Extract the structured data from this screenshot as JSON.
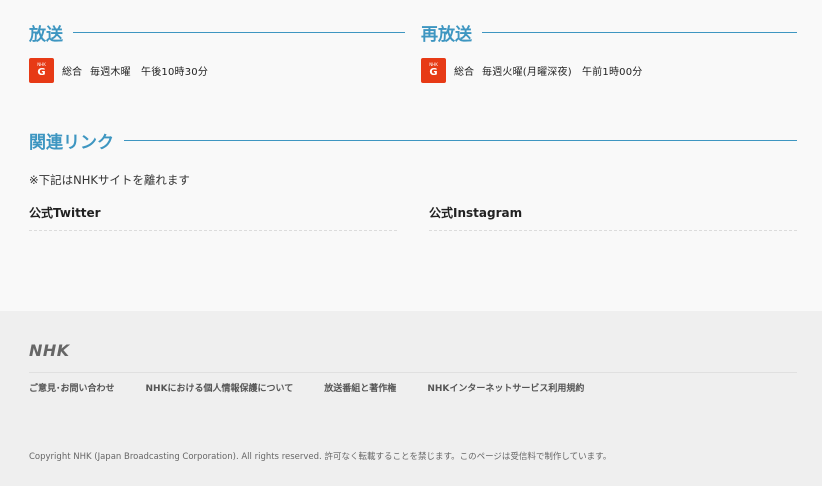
{
  "broadcast": {
    "title": "放送",
    "badge_small": "NHK",
    "badge_letter": "G",
    "channel": "総合",
    "schedule": "毎週木曜　午後10時30分"
  },
  "rebroadcast": {
    "title": "再放送",
    "badge_small": "NHK",
    "badge_letter": "G",
    "channel": "総合",
    "schedule": "毎週火曜(月曜深夜)　午前1時00分"
  },
  "related": {
    "title": "関連リンク",
    "note": "※下記はNHKサイトを離れます",
    "links": [
      {
        "label": "公式Twitter"
      },
      {
        "label": "公式Instagram"
      }
    ]
  },
  "footer": {
    "logo": "NHK",
    "links": [
      {
        "label": "ご意見･お問い合わせ"
      },
      {
        "label": "NHKにおける個人情報保護について"
      },
      {
        "label": "放送番組と著作権"
      },
      {
        "label": "NHKインターネットサービス利用規約"
      }
    ],
    "copyright": "Copyright NHK (Japan Broadcasting Corporation). All rights reserved. 許可なく転載することを禁じます。このページは受信料で制作しています。"
  },
  "colors": {
    "accent": "#3e96c1",
    "badge": "#e73a16"
  }
}
